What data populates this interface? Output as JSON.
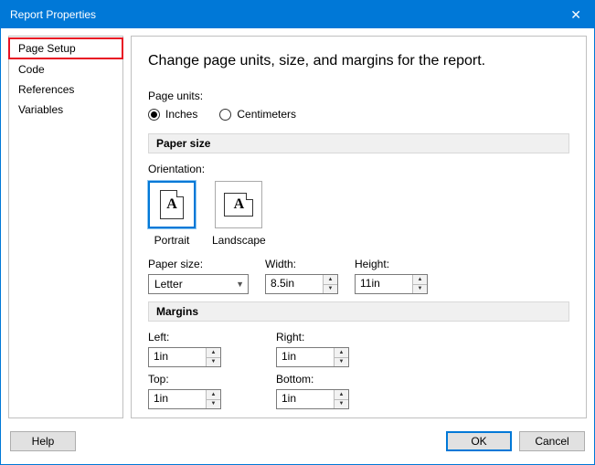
{
  "window": {
    "title": "Report Properties"
  },
  "sidebar": {
    "items": [
      {
        "label": "Page Setup",
        "selected": true
      },
      {
        "label": "Code"
      },
      {
        "label": "References"
      },
      {
        "label": "Variables"
      }
    ]
  },
  "main": {
    "heading": "Change page units, size, and margins for the report.",
    "page_units": {
      "label": "Page units:",
      "options": {
        "inches": "Inches",
        "centimeters": "Centimeters"
      },
      "selected": "inches"
    },
    "paper_size": {
      "section": "Paper size",
      "orientation_label": "Orientation:",
      "portrait": "Portrait",
      "landscape": "Landscape",
      "orientation_selected": "portrait",
      "size_label": "Paper size:",
      "size_value": "Letter",
      "width_label": "Width:",
      "width_value": "8.5in",
      "height_label": "Height:",
      "height_value": "11in"
    },
    "margins": {
      "section": "Margins",
      "left_label": "Left:",
      "left_value": "1in",
      "right_label": "Right:",
      "right_value": "1in",
      "top_label": "Top:",
      "top_value": "1in",
      "bottom_label": "Bottom:",
      "bottom_value": "1in"
    }
  },
  "footer": {
    "help": "Help",
    "ok": "OK",
    "cancel": "Cancel"
  }
}
